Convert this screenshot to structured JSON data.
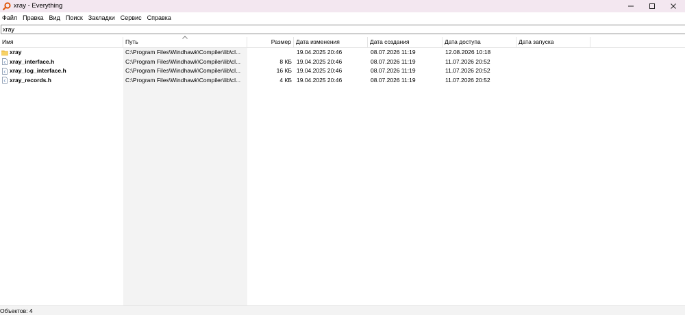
{
  "window": {
    "title": "xray - Everything",
    "accent": "#e05a10"
  },
  "menu": [
    "Файл",
    "Правка",
    "Вид",
    "Поиск",
    "Закладки",
    "Сервис",
    "Справка"
  ],
  "search": {
    "value": "xray"
  },
  "columns": {
    "name": "Имя",
    "path": "Путь",
    "size": "Размер",
    "modified": "Дата изменения",
    "created": "Дата создания",
    "accessed": "Дата доступа",
    "run": "Дата запуска"
  },
  "rows": [
    {
      "icon": "folder-icon",
      "name": "xray",
      "path": "C:\\Program Files\\Windhawk\\Compiler\\lib\\cl...",
      "size": "",
      "modified": "19.04.2025 20:46",
      "created": "08.07.2026 11:19",
      "accessed": "12.08.2026 10:18",
      "run": ""
    },
    {
      "icon": "c-header-file-icon",
      "name": "xray_interface.h",
      "path": "C:\\Program Files\\Windhawk\\Compiler\\lib\\cl...",
      "size": "8 КБ",
      "modified": "19.04.2025 20:46",
      "created": "08.07.2026 11:19",
      "accessed": "11.07.2026 20:52",
      "run": ""
    },
    {
      "icon": "c-header-file-icon",
      "name": "xray_log_interface.h",
      "path": "C:\\Program Files\\Windhawk\\Compiler\\lib\\cl...",
      "size": "16 КБ",
      "modified": "19.04.2025 20:46",
      "created": "08.07.2026 11:19",
      "accessed": "11.07.2026 20:52",
      "run": ""
    },
    {
      "icon": "c-header-file-icon",
      "name": "xray_records.h",
      "path": "C:\\Program Files\\Windhawk\\Compiler\\lib\\cl...",
      "size": "4 КБ",
      "modified": "19.04.2025 20:46",
      "created": "08.07.2026 11:19",
      "accessed": "11.07.2026 20:52",
      "run": ""
    }
  ],
  "status": {
    "text": "Объектов: 4"
  }
}
